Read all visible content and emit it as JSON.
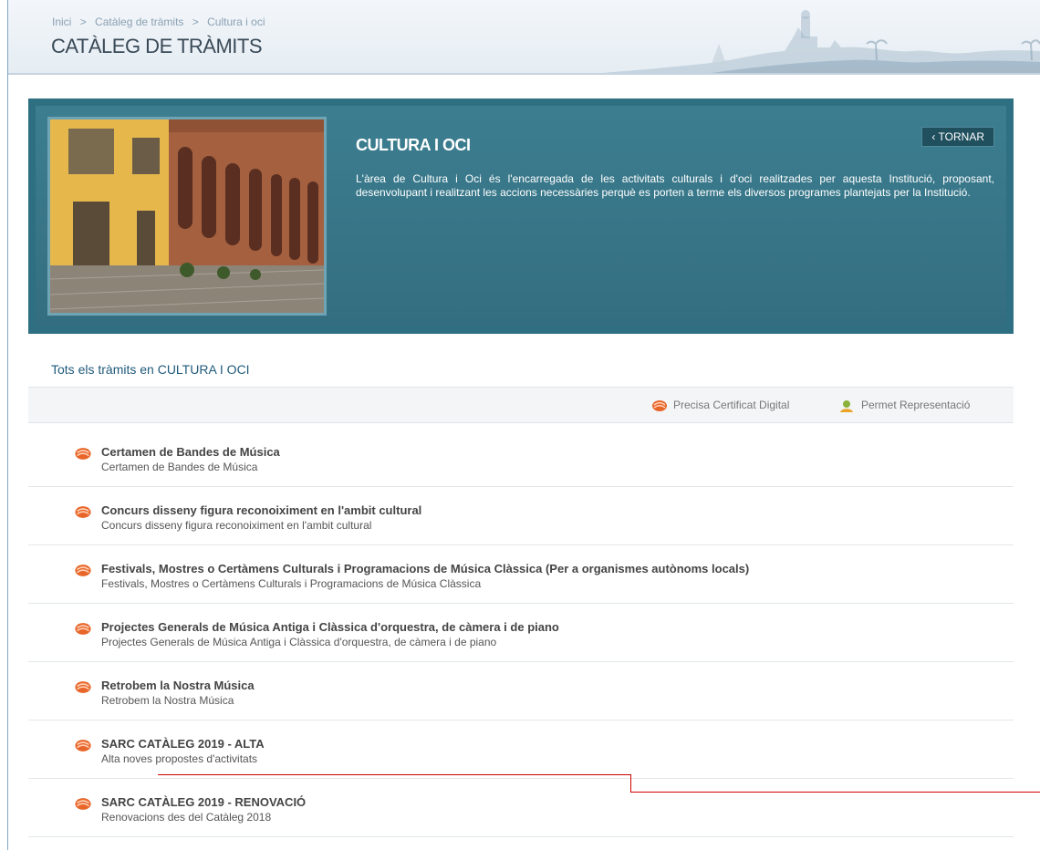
{
  "header": {
    "breadcrumb": [
      "Inici",
      "Catàleg de tràmits",
      "Cultura i oci"
    ],
    "breadcrumb_sep": ">",
    "title": "CATÀLEG DE TRÀMITS"
  },
  "banner": {
    "title": "CULTURA I OCI",
    "back_label": "TORNAR",
    "back_icon": "chevron-left-icon",
    "description": "L'àrea de Cultura i Oci és l'encarregada de les activitats culturals i d'oci realitzades per aquesta Institució, proposant, desenvolupant i realitzant les accions necessàries perquè es porten a terme els diversos programes plantejats per la Institució."
  },
  "section": {
    "title": "Tots els tràmits en CULTURA I OCI"
  },
  "legend": {
    "digital_certificate": "Precisa Certificat Digital",
    "representation": "Permet Representació"
  },
  "procedures": [
    {
      "title": "Certamen de Bandes de Música",
      "subtitle": "Certamen de Bandes de Música"
    },
    {
      "title": "Concurs disseny figura reconoiximent en l'ambit cultural",
      "subtitle": "Concurs disseny figura reconoiximent en l'ambit cultural"
    },
    {
      "title": "Festivals, Mostres o Certàmens Culturals i Programacions de Música Clàssica (Per a organismes autònoms locals)",
      "subtitle": "Festivals, Mostres o Certàmens Culturals i Programacions de Música Clàssica"
    },
    {
      "title": "Projectes Generals de Música Antiga i Clàssica d'orquestra, de càmera i de piano",
      "subtitle": "Projectes Generals de Música Antiga i Clàssica d'orquestra, de càmera i de piano"
    },
    {
      "title": "Retrobem la Nostra Música",
      "subtitle": "Retrobem la Nostra Música"
    },
    {
      "title": "SARC CATÀLEG 2019 - ALTA",
      "subtitle": "Alta noves propostes d'activitats"
    },
    {
      "title": "SARC CATÀLEG 2019 - RENOVACIÓ",
      "subtitle": "Renovacions des del Catàleg 2018"
    }
  ],
  "colors": {
    "banner_bg": "#2f6f82",
    "cert_icon": "#e8662a",
    "rep_icon": "#8bb23a",
    "annotation_line": "#d00000"
  }
}
